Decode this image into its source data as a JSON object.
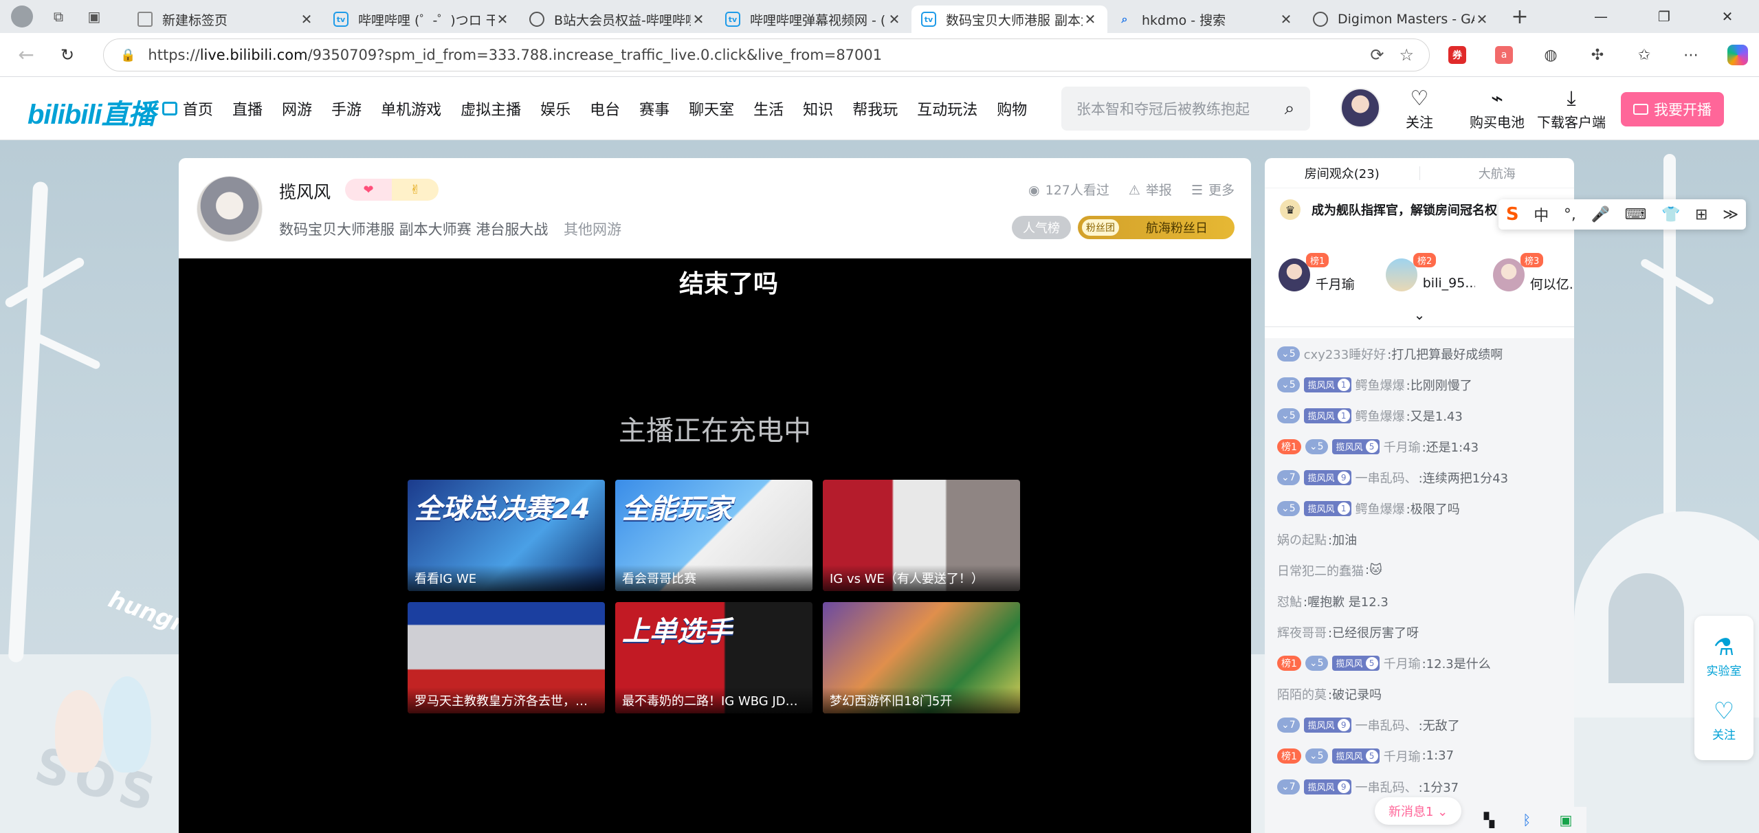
{
  "browser": {
    "tabs": [
      {
        "title": "新建标签页",
        "favicon": "page-icon",
        "active": false
      },
      {
        "title": "哔哩哔哩 (゜-゜)つロ 干杯",
        "favicon": "bilibili-icon",
        "active": false
      },
      {
        "title": "B站大会员权益-哔哩哔哩",
        "favicon": "globe-icon",
        "active": false
      },
      {
        "title": "哔哩哔哩弹幕视频网 - (",
        "favicon": "bilibili-icon",
        "active": false
      },
      {
        "title": "数码宝贝大师港服 副本大",
        "favicon": "bilibili-icon",
        "active": true
      },
      {
        "title": "hkdmo - 搜索",
        "favicon": "search-icon",
        "active": false
      },
      {
        "title": "Digimon Masters - GAME",
        "favicon": "globe-icon",
        "active": false
      }
    ],
    "url_prefix": "https://",
    "url_host": "live.bilibili.com",
    "url_rest": "/9350709?spm_id_from=333.788.increase_traffic_live.0.click&live_from=87001"
  },
  "header": {
    "logo": "bilibili直播",
    "nav": [
      "首页",
      "直播",
      "网游",
      "手游",
      "单机游戏",
      "虚拟主播",
      "娱乐",
      "电台",
      "赛事",
      "聊天室",
      "生活",
      "知识",
      "帮我玩",
      "互动玩法",
      "购物"
    ],
    "search_placeholder": "张本智和夺冠后被教练抱起",
    "follow": "关注",
    "battery": "购买电池",
    "download": "下载客户端",
    "go_live": "我要开播"
  },
  "room": {
    "streamer": "揽风风",
    "title": "数码宝贝大师港服 副本大师赛 港台服大战",
    "area": "其他网游",
    "viewers": "127人看过",
    "report": "举报",
    "more": "更多",
    "popularity": "人气榜",
    "fan_tag": "粉丝团",
    "fan_day": "航海粉丝日"
  },
  "player": {
    "overlay_title": "结束了吗",
    "status": "主播正在充电中",
    "recommendations": [
      {
        "caption": "看看IG WE",
        "big": "全球总决赛24"
      },
      {
        "caption": "看会哥哥比赛",
        "big": "全能玩家"
      },
      {
        "caption": "IG vs WE（有人要送了！）",
        "big": ""
      },
      {
        "caption": "罗马天主教教皇方济各去世，…",
        "big": ""
      },
      {
        "caption": "最不毒奶的二路！IG WBG JD…",
        "big": "上单选手"
      },
      {
        "caption": "梦幻西游怀旧18门5开",
        "big": ""
      }
    ]
  },
  "sidebar": {
    "tab_audience": "房间观众(23)",
    "tab_fleet": "大航海",
    "fleet_promo": "成为舰队指挥官，解锁房间冠名权",
    "top3": [
      {
        "rank": "榜1",
        "name": "千月瑜"
      },
      {
        "rank": "榜2",
        "name": "bili_95..."
      },
      {
        "rank": "榜3",
        "name": "何以亿..."
      }
    ],
    "messages": [
      {
        "rank": "",
        "level": "5",
        "medal": "",
        "medal_lv": "",
        "user": "cxy233睡好好",
        "text": ":打几把算最好成绩啊"
      },
      {
        "rank": "",
        "level": "5",
        "medal": "揽风风",
        "medal_lv": "1",
        "user": "鳄鱼爆爆",
        "text": ":比刚刚慢了"
      },
      {
        "rank": "",
        "level": "5",
        "medal": "揽风风",
        "medal_lv": "1",
        "user": "鳄鱼爆爆",
        "text": ":又是1.43"
      },
      {
        "rank": "榜1",
        "level": "5",
        "medal": "揽风风",
        "medal_lv": "5",
        "user": "千月瑜",
        "text": ":还是1:43"
      },
      {
        "rank": "",
        "level": "7",
        "medal": "揽风风",
        "medal_lv": "9",
        "user": "一串乱码、",
        "text": ":连续两把1分43"
      },
      {
        "rank": "",
        "level": "5",
        "medal": "揽风风",
        "medal_lv": "1",
        "user": "鳄鱼爆爆",
        "text": ":极限了吗"
      },
      {
        "rank": "",
        "level": "",
        "medal": "",
        "medal_lv": "",
        "user": "娲の起點",
        "text": ":加油"
      },
      {
        "rank": "",
        "level": "",
        "medal": "",
        "medal_lv": "",
        "user": "日常犯二的蠢猫",
        "text": ":🐱"
      },
      {
        "rank": "",
        "level": "",
        "medal": "",
        "medal_lv": "",
        "user": "怼鮎",
        "text": ":喔抱歉 是12.3"
      },
      {
        "rank": "",
        "level": "",
        "medal": "",
        "medal_lv": "",
        "user": "辉夜哥哥",
        "text": ":已经很厉害了呀"
      },
      {
        "rank": "榜1",
        "level": "5",
        "medal": "揽风风",
        "medal_lv": "5",
        "user": "千月瑜",
        "text": ":12.3是什么"
      },
      {
        "rank": "",
        "level": "",
        "medal": "",
        "medal_lv": "",
        "user": "陌陌的莫",
        "text": ":破记录吗"
      },
      {
        "rank": "",
        "level": "7",
        "medal": "揽风风",
        "medal_lv": "9",
        "user": "一串乱码、",
        "text": ":无敌了"
      },
      {
        "rank": "榜1",
        "level": "5",
        "medal": "揽风风",
        "medal_lv": "5",
        "user": "千月瑜",
        "text": ":1:37"
      },
      {
        "rank": "",
        "level": "7",
        "medal": "揽风风",
        "medal_lv": "9",
        "user": "一串乱码、",
        "text": ":1分37"
      }
    ],
    "new_messages": "新消息1 ⌄",
    "ime_chinese": "中",
    "lab": "实验室",
    "follow": "关注"
  },
  "scene_text": {
    "hungry": "hungry",
    "sos": "SOS"
  },
  "colors": {
    "bili_blue": "#00a1d6",
    "bili_pink": "#ff6699"
  }
}
